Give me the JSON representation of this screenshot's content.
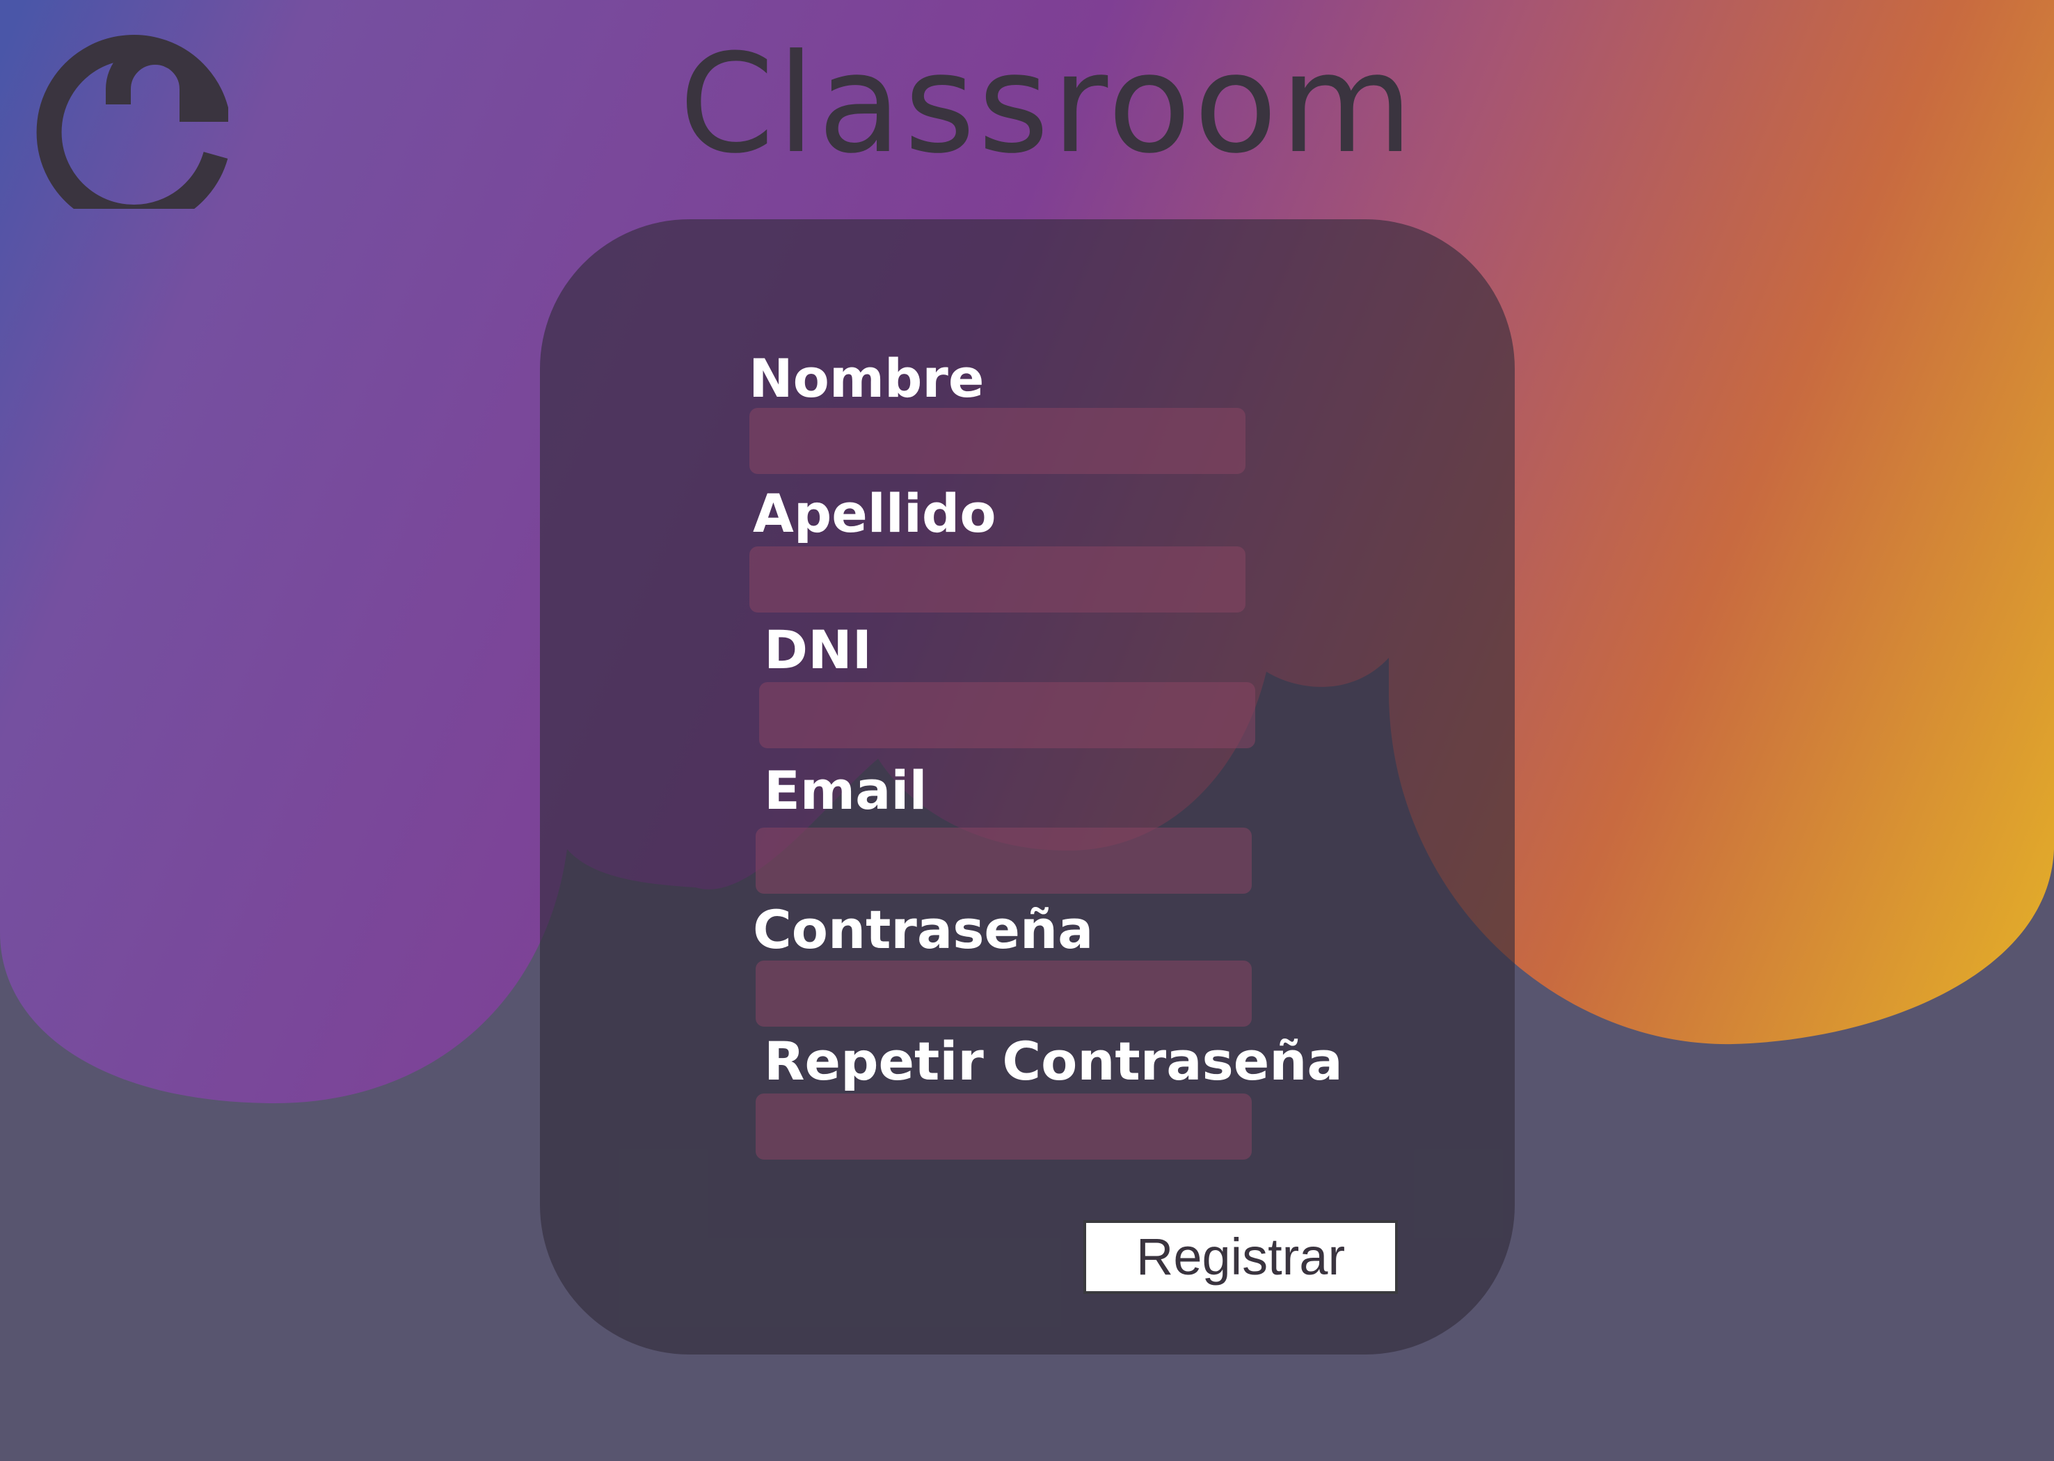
{
  "header": {
    "logo_icon": "spiral-e-logo-icon",
    "title": "Classroom"
  },
  "form": {
    "fields": [
      {
        "name": "nombre",
        "label": "Nombre",
        "value": "",
        "placeholder": ""
      },
      {
        "name": "apellido",
        "label": "Apellido",
        "value": "",
        "placeholder": ""
      },
      {
        "name": "dni",
        "label": "DNI",
        "value": "",
        "placeholder": ""
      },
      {
        "name": "email",
        "label": "Email",
        "value": "",
        "placeholder": ""
      },
      {
        "name": "contrasena",
        "label": "Contraseña",
        "value": "",
        "placeholder": ""
      },
      {
        "name": "repetir-contrasena",
        "label": "Repetir Contraseña",
        "value": "",
        "placeholder": ""
      }
    ],
    "submit_label": "Registrar"
  },
  "colors": {
    "background": "#58556f",
    "blob_purple": "#7b4aa0",
    "blob_orange": "#c9683f",
    "blob_yellow": "#e2a82a",
    "card": "#423f4c",
    "input_fill": "#6e4560",
    "text_dark": "#3a343f",
    "text_light": "#ffffff"
  }
}
